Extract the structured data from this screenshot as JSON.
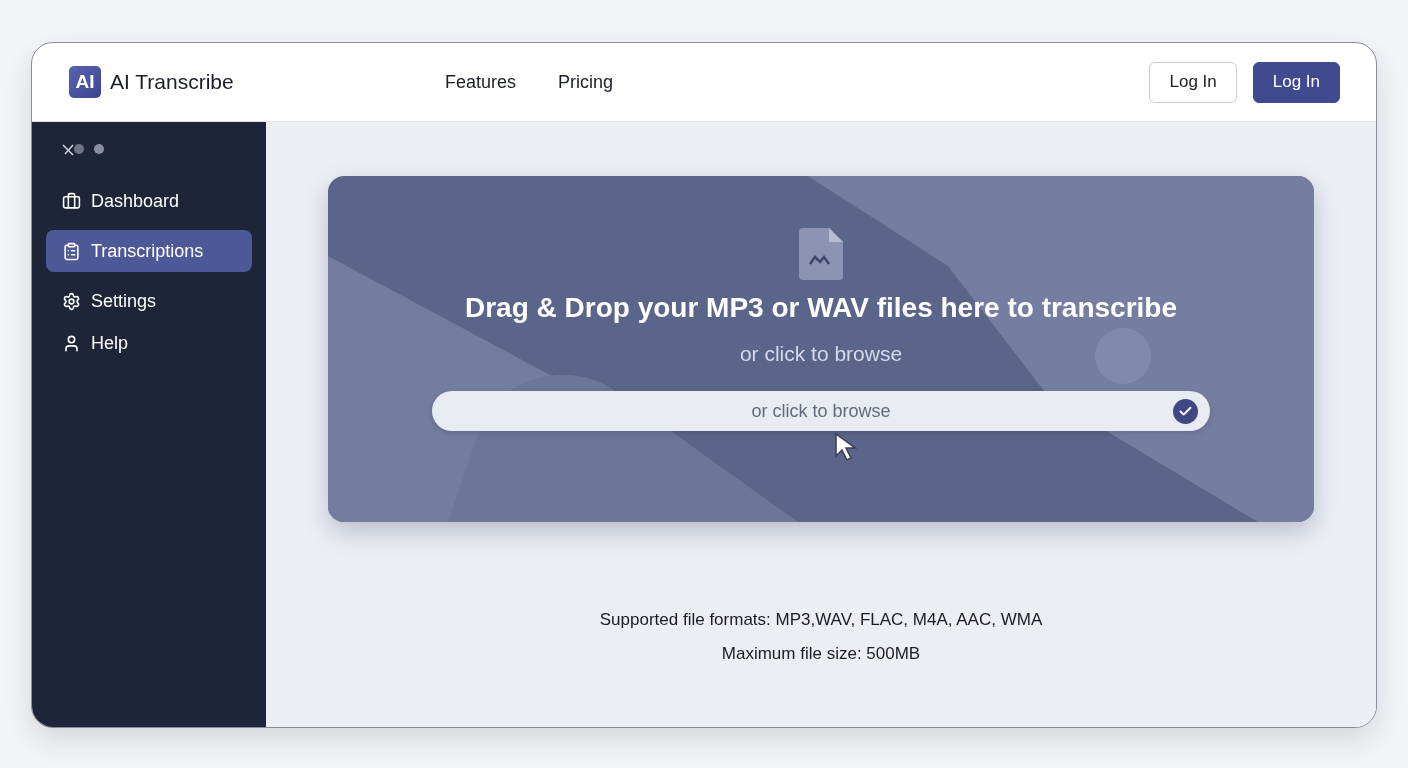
{
  "brand": {
    "name": "AI Transcribe",
    "logo_text": "AI"
  },
  "nav": [
    {
      "label": "Features"
    },
    {
      "label": "Pricing"
    }
  ],
  "header_buttons": [
    {
      "label": "Log In",
      "kind": "outline"
    },
    {
      "label": "Log In",
      "kind": "primary"
    }
  ],
  "sidebar": {
    "items": [
      {
        "label": "Dashboard",
        "selected": false
      },
      {
        "label": "Transcriptions",
        "selected": true
      },
      {
        "label": "Settings",
        "selected": false
      },
      {
        "label": "Help",
        "selected": false
      }
    ]
  },
  "upload": {
    "title": "Drag & Drop your MP3 or WAV files here to transcribe",
    "subtitle": "or click to browse",
    "field": {
      "placeholder": "or click to browse",
      "checked": true
    }
  },
  "notes": [
    "Supported file formats: MP3,WAV, FLAC, M4A, AAC, WMA",
    "Maximum file size: 500MB"
  ]
}
